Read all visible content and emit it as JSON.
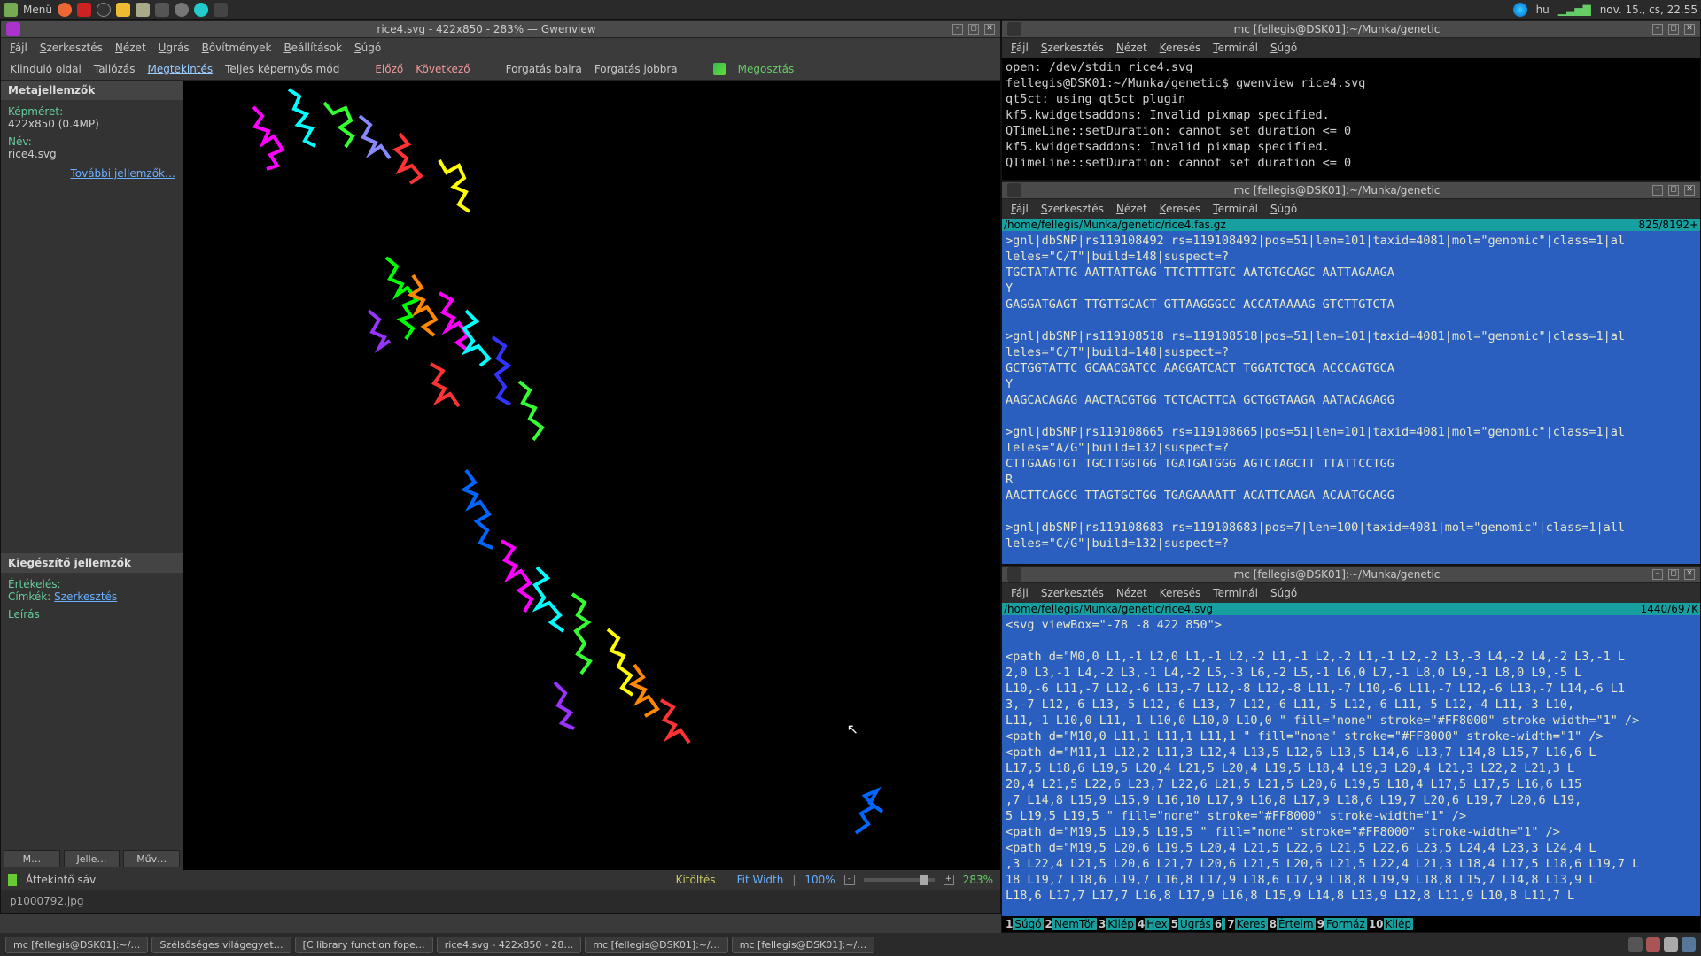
{
  "panel": {
    "menu": "Menü",
    "lang": "hu",
    "clock": "nov. 15., cs, 22.55"
  },
  "gwenview": {
    "title": "rice4.svg - 422x850 - 283% — Gwenview",
    "menu": {
      "file": "Fájl",
      "edit": "Szerkesztés",
      "view": "Nézet",
      "go": "Ugrás",
      "plugins": "Bővítmények",
      "settings": "Beállítások",
      "help": "Súgó"
    },
    "toolbar": {
      "start": "Kiinduló oldal",
      "browse": "Tallózás",
      "view": "Megtekintés",
      "fullscreen": "Teljes képernyős mód",
      "prev": "Előző",
      "next": "Következő",
      "rotleft": "Forgatás balra",
      "rotright": "Forgatás jobbra",
      "share": "Megosztás"
    },
    "meta": {
      "title": "Metajellemzők",
      "size_label": "Képméret:",
      "size_value": "422x850 (0.4MP)",
      "name_label": "Név:",
      "name_value": "rice4.svg",
      "more": "További jellemzők…"
    },
    "extra": {
      "title": "Kiegészítő jellemzők",
      "rating": "Értékelés:",
      "tags": "Címkék:",
      "tags_edit": "Szerkesztés",
      "desc": "Leírás"
    },
    "sidebar_tabs": {
      "a": "M…",
      "b": "Jelle…",
      "c": "Műv…"
    },
    "status": {
      "thumbbar": "Áttekintő sáv",
      "fill": "Kitöltés",
      "fitw": "Fit Width",
      "pct100": "100%",
      "zoom": "283%",
      "thumb": "p1000792.jpg"
    }
  },
  "terminals": {
    "titlebar": "mc [fellegis@DSK01]:~/Munka/genetic",
    "menu": {
      "file": "Fájl",
      "edit": "Szerkesztés",
      "view": "Nézet",
      "search": "Keresés",
      "terminal": "Terminál",
      "help": "Súgó"
    },
    "t1_lines": [
      "open: /dev/stdin rice4.svg",
      "fellegis@DSK01:~/Munka/genetic$ gwenview rice4.svg",
      "qt5ct: using qt5ct plugin",
      "kf5.kwidgetsaddons: Invalid pixmap specified.",
      "QTimeLine::setDuration: cannot set duration <= 0",
      "kf5.kwidgetsaddons: Invalid pixmap specified.",
      "QTimeLine::setDuration: cannot set duration <= 0"
    ],
    "t2_head_path": "/home/fellegis/Munka/genetic/rice4.fas.gz",
    "t2_head_pos": "825/8192+",
    "t2_lines": [
      ">gnl|dbSNP|rs119108492 rs=119108492|pos=51|len=101|taxid=4081|mol=\"genomic\"|class=1|al",
      "leles=\"C/T\"|build=148|suspect=?",
      "TGCTATATTG AATTATTGAG TTCTTTTGTC AATGTGCAGC AATTAGAAGA",
      "Y",
      "GAGGATGAGT TTGTTGCACT GTTAAGGGCC ACCATAAAAG GTCTTGTCTA",
      "",
      ">gnl|dbSNP|rs119108518 rs=119108518|pos=51|len=101|taxid=4081|mol=\"genomic\"|class=1|al",
      "leles=\"C/T\"|build=148|suspect=?",
      "GCTGGTATTC GCAACGATCC AAGGATCACT TGGATCTGCA ACCCAGTGCA",
      "Y",
      "AAGCACAGAG AACTACGTGG TCTCACTTCA GCTGGTAAGA AATACAGAGG",
      "",
      ">gnl|dbSNP|rs119108665 rs=119108665|pos=51|len=101|taxid=4081|mol=\"genomic\"|class=1|al",
      "leles=\"A/G\"|build=132|suspect=?",
      "CTTGAAGTGT TGCTTGGTGG TGATGATGGG AGTCTAGCTT TTATTCCTGG",
      "R",
      "AACTTCAGCG TTAGTGCTGG TGAGAAAATT ACATTCAAGA ACAATGCAGG",
      "",
      ">gnl|dbSNP|rs119108683 rs=119108683|pos=7|len=100|taxid=4081|mol=\"genomic\"|class=1|all",
      "leles=\"C/G\"|build=132|suspect=?"
    ],
    "t3_head_path": "/home/fellegis/Munka/genetic/rice4.svg",
    "t3_head_pos": "1440/697K",
    "t3_lines": [
      "<svg viewBox=\"-78 -8 422 850\">",
      "",
      "<path d=\"M0,0 L1,-1 L2,0 L1,-1 L2,-2 L1,-1 L2,-2 L1,-1 L2,-2 L3,-3 L4,-2 L4,-2 L3,-1 L",
      "2,0 L3,-1 L4,-2 L3,-1 L4,-2 L5,-3 L6,-2 L5,-1 L6,0 L7,-1 L8,0 L9,-1 L8,0 L9,-5 L",
      "L10,-6 L11,-7 L12,-6 L13,-7 L12,-8 L12,-8 L11,-7 L10,-6 L11,-7 L12,-6 L13,-7 L14,-6 L1",
      "3,-7 L12,-6 L13,-5 L12,-6 L13,-7 L12,-6 L11,-5 L12,-6 L11,-5 L12,-4 L11,-3 L10,",
      "L11,-1 L10,0 L11,-1 L10,0 L10,0 L10,0 \" fill=\"none\" stroke=\"#FF8000\" stroke-width=\"1\" />",
      "<path d=\"M10,0 L11,1 L11,1 L11,1 \" fill=\"none\" stroke=\"#FF8000\" stroke-width=\"1\" />",
      "<path d=\"M11,1 L12,2 L11,3 L12,4 L13,5 L12,6 L13,5 L14,6 L13,7 L14,8 L15,7 L16,6 L",
      "L17,5 L18,6 L19,5 L20,4 L21,5 L20,4 L19,5 L18,4 L19,3 L20,4 L21,3 L22,2 L21,3 L",
      "20,4 L21,5 L22,6 L23,7 L22,6 L21,5 L21,5 L20,6 L19,5 L18,4 L17,5 L17,5 L16,6 L15",
      ",7 L14,8 L15,9 L15,9 L16,10 L17,9 L16,8 L17,9 L18,6 L19,7 L20,6 L19,7 L20,6 L19,",
      "5 L19,5 L19,5 \" fill=\"none\" stroke=\"#FF8000\" stroke-width=\"1\" />",
      "<path d=\"M19,5 L19,5 L19,5 \" fill=\"none\" stroke=\"#FF8000\" stroke-width=\"1\" />",
      "<path d=\"M19,5 L20,6 L19,5 L20,4 L21,5 L22,6 L21,5 L22,6 L23,5 L24,4 L23,3 L24,4 L",
      ",3 L22,4 L21,5 L20,6 L21,7 L20,6 L21,5 L20,6 L21,5 L22,4 L21,3 L18,4 L17,5 L18,6 L19,7 L",
      "18 L19,7 L18,6 L19,7 L16,8 L17,9 L18,6 L17,9 L18,8 L19,9 L18,8 L15,7 L14,8 L13,9 L",
      "L18,6 L17,7 L17,7 L16,8 L17,9 L16,8 L15,9 L14,8 L13,9 L12,8 L11,9 L10,8 L11,7 L"
    ],
    "mcfoot": [
      [
        "1",
        "Súgó"
      ],
      [
        "2",
        "NemTör"
      ],
      [
        "3",
        "Kilép"
      ],
      [
        "4",
        "Hex"
      ],
      [
        "5",
        "Ugrás"
      ],
      [
        "6",
        ""
      ],
      [
        "7",
        "Keres"
      ],
      [
        "8",
        "Értelm"
      ],
      [
        "9",
        "Formáz"
      ],
      [
        "10",
        "Kilép"
      ]
    ]
  },
  "taskbar": {
    "items": [
      "mc [fellegis@DSK01]:~/…",
      "Szélsőséges világegyet…",
      "[C library function fope…",
      "rice4.svg - 422x850 - 28…",
      "mc [fellegis@DSK01]:~/…",
      "mc [fellegis@DSK01]:~/…"
    ]
  }
}
